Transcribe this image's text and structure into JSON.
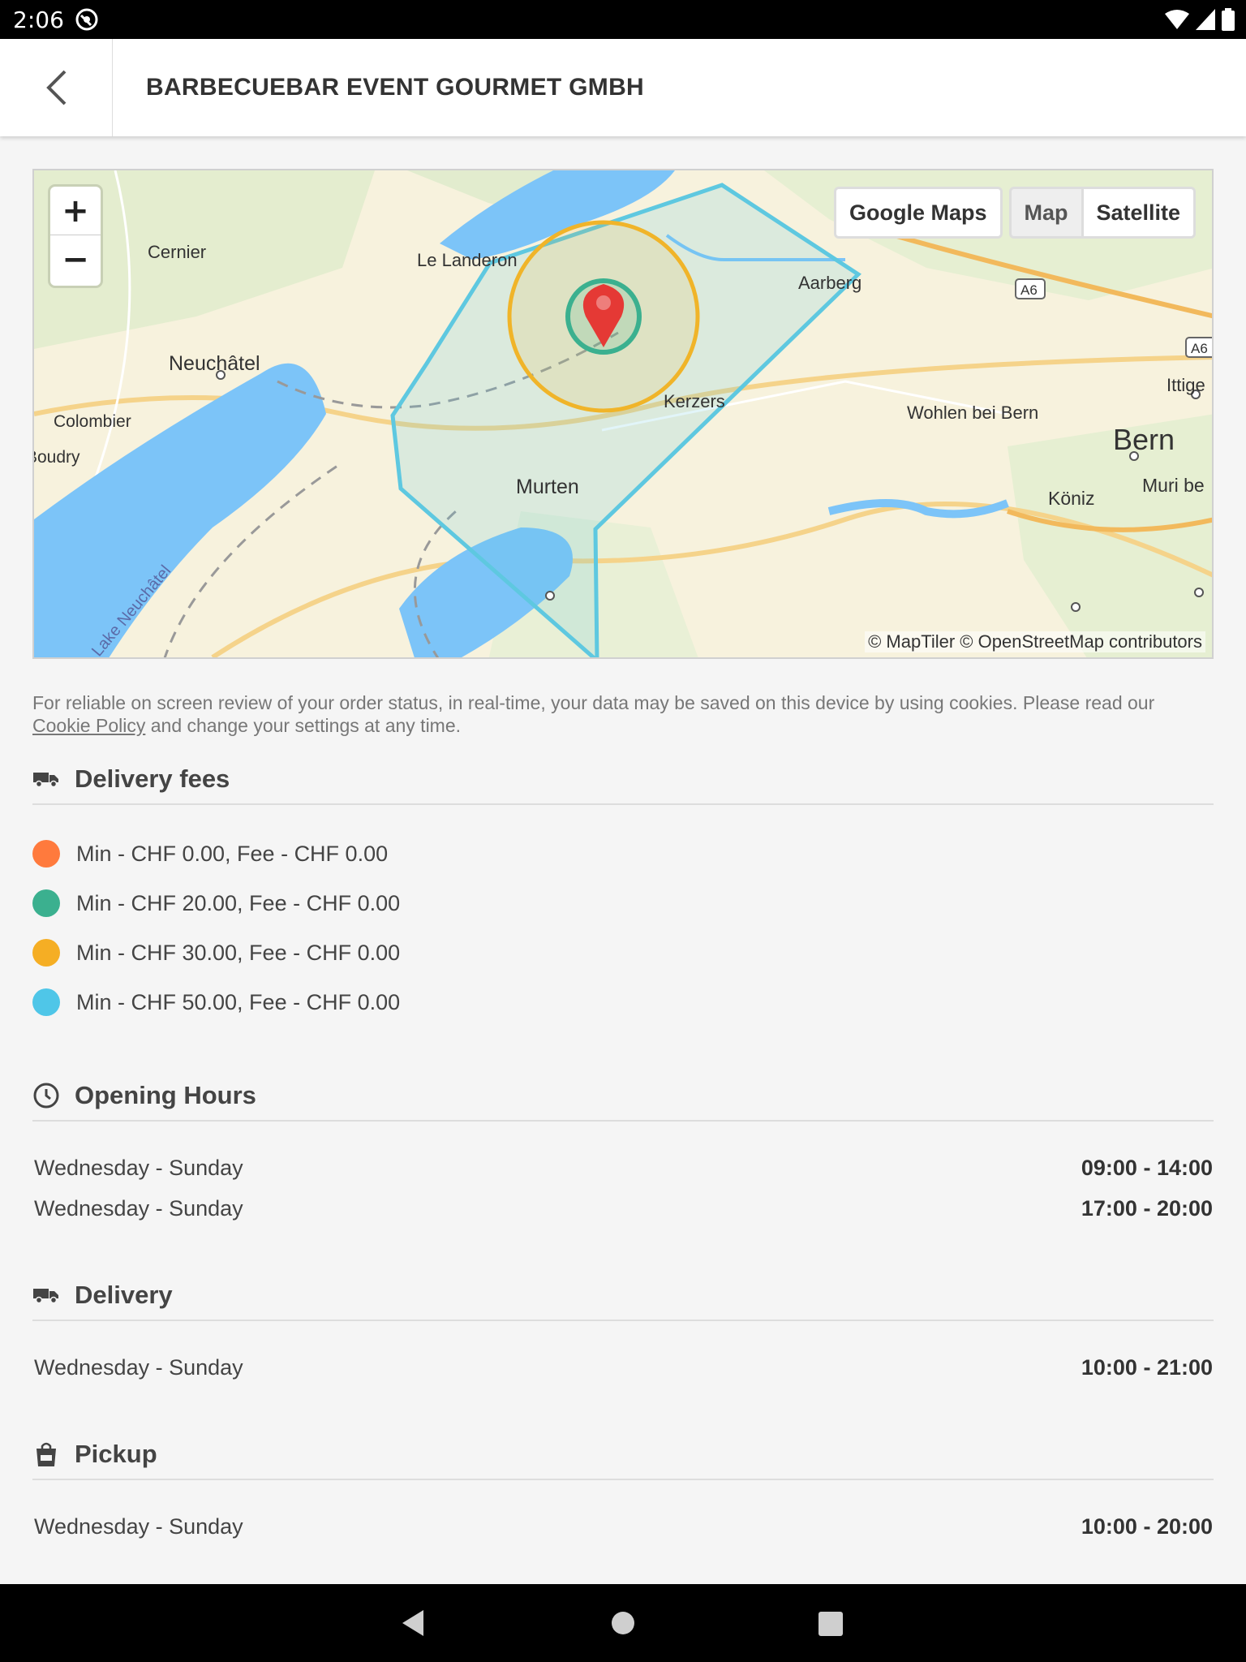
{
  "status_bar": {
    "time": "2:06"
  },
  "header": {
    "title": "BARBECUEBAR EVENT GOURMET GMBH"
  },
  "map": {
    "zoom_in": "+",
    "zoom_out": "−",
    "buttons": {
      "google_maps": "Google Maps",
      "map": "Map",
      "satellite": "Satellite"
    },
    "selected_type": "Map",
    "places": {
      "cernier": "Cernier",
      "le_landeron": "Le Landeron",
      "aarberg": "Aarberg",
      "neuchatel": "Neuchâtel",
      "colombier": "Colombier",
      "boudry": "Boudry",
      "lake": "Lake Neuchâtel",
      "kerzers": "Kerzers",
      "wohlen": "Wohlen bei Bern",
      "bern": "Bern",
      "ittigen": "Ittige",
      "murten": "Murten",
      "koniz": "Köniz",
      "muri": "Muri be",
      "a6": "A6",
      "a6b": "A6"
    },
    "attribution": "© MapTiler © OpenStreetMap contributors",
    "colors": {
      "water": "#7cc4f8",
      "land": "#f7f2dd",
      "green": "#dcebc8",
      "zone_blue": "#5ec8e0",
      "zone_yellow": "#f0b429",
      "zone_green": "#3bb08f",
      "pin": "#e53935"
    }
  },
  "cookie_notice": {
    "text": "For reliable on screen review of your order status, in real-time, your data may be saved on this device by using cookies. Please read our",
    "link": "Cookie Policy",
    "text_after": "and change your settings at any time."
  },
  "delivery_fees": {
    "title": "Delivery fees",
    "items": [
      {
        "label": "Min - CHF 0.00, Fee - CHF 0.00",
        "color": "#ff7a3d"
      },
      {
        "label": "Min - CHF 20.00, Fee - CHF 0.00",
        "color": "#3bb08f"
      },
      {
        "label": "Min - CHF 30.00, Fee - CHF 0.00",
        "color": "#f5ae24"
      },
      {
        "label": "Min - CHF 50.00, Fee - CHF 0.00",
        "color": "#4fc6e8"
      }
    ]
  },
  "opening_hours": {
    "title": "Opening Hours",
    "rows": [
      {
        "days": "Wednesday - Sunday",
        "range": "09:00 - 14:00"
      },
      {
        "days": "Wednesday - Sunday",
        "range": "17:00 - 20:00"
      }
    ]
  },
  "delivery": {
    "title": "Delivery",
    "rows": [
      {
        "days": "Wednesday - Sunday",
        "range": "10:00 - 21:00"
      }
    ]
  },
  "pickup": {
    "title": "Pickup",
    "rows": [
      {
        "days": "Wednesday - Sunday",
        "range": "10:00 - 20:00"
      }
    ]
  }
}
